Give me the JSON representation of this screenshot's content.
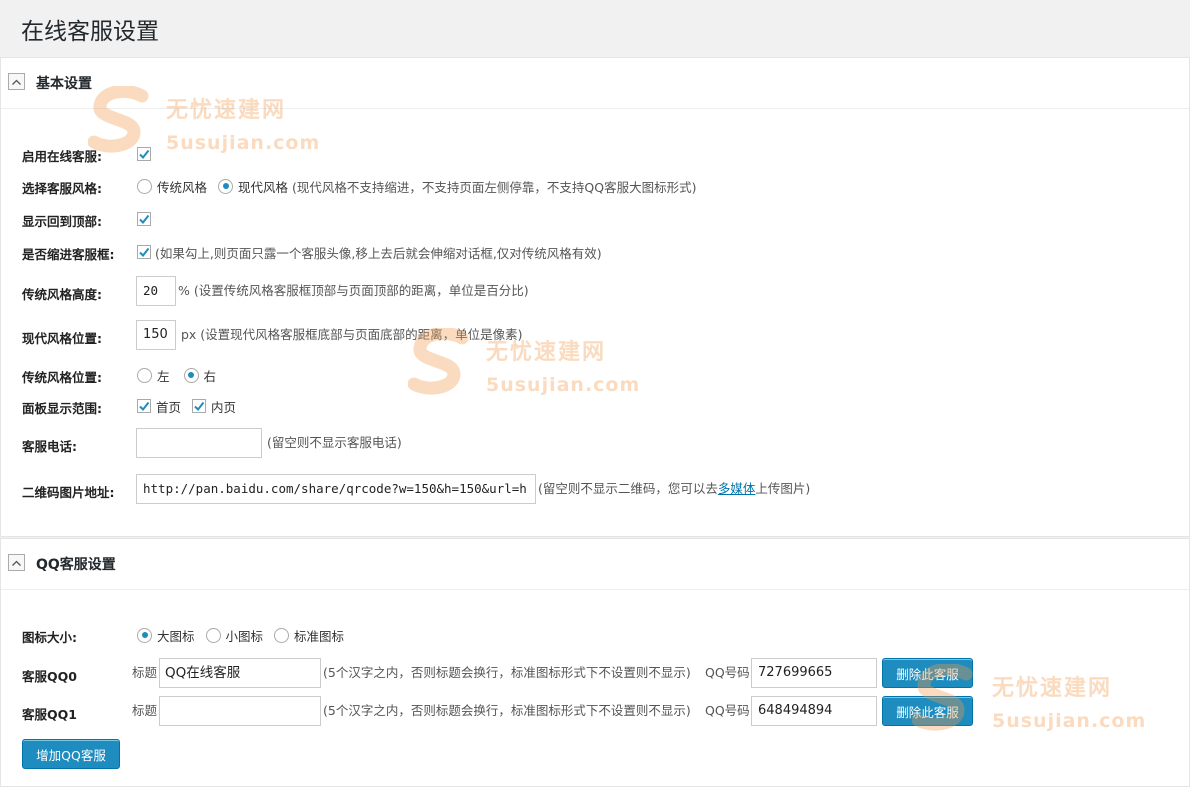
{
  "page": {
    "title": "在线客服设置"
  },
  "basic": {
    "title": "基本设置",
    "enable_label": "启用在线客服:",
    "style_label": "选择客服风格:",
    "style_options": [
      "传统风格",
      "现代风格"
    ],
    "style_selected": "现代风格",
    "style_note": "(现代风格不支持缩进，不支持页面左侧停靠，不支持QQ客服大图标形式)",
    "back_top_label": "显示回到顶部:",
    "indent_label": "是否缩进客服框:",
    "indent_note": "(如果勾上,则页面只露一个客服头像,移上去后就会伸缩对话框,仅对传统风格有效)",
    "height_label": "传统风格高度:",
    "height_value": "20",
    "height_note": "% (设置传统风格客服框顶部与页面顶部的距离，单位是百分比)",
    "modern_pos_label": "现代风格位置:",
    "modern_pos_value": "150",
    "modern_pos_note": "px (设置现代风格客服框底部与页面底部的距离，单位是像素)",
    "trad_pos_label": "传统风格位置:",
    "trad_pos_options": [
      "左",
      "右"
    ],
    "trad_pos_selected": "右",
    "scope_label": "面板显示范围:",
    "scope_options": [
      "首页",
      "内页"
    ],
    "phone_label": "客服电话:",
    "phone_value": "",
    "phone_note": "(留空则不显示客服电话)",
    "qrcode_label": "二维码图片地址:",
    "qrcode_value": "http://pan.baidu.com/share/qrcode?w=150&h=150&url=h",
    "qrcode_note_before": "(留空则不显示二维码，您可以去",
    "qrcode_note_link": "多媒体",
    "qrcode_note_after": "上传图片)"
  },
  "qq": {
    "title": "QQ客服设置",
    "icon_size_label": "图标大小:",
    "icon_size_options": [
      "大图标",
      "小图标",
      "标准图标"
    ],
    "icon_size_selected": "大图标",
    "title_prefix": "标题",
    "title_note": "(5个汉字之内，否则标题会换行，标准图标形式下不设置则不显示)",
    "qq_no_label": "QQ号码",
    "delete_label": "删除此客服",
    "add_label": "增加QQ客服",
    "rows": [
      {
        "label": "客服QQ0",
        "title": "QQ在线客服",
        "qq": "727699665"
      },
      {
        "label": "客服QQ1",
        "title": "",
        "qq": "648494894"
      }
    ]
  },
  "watermark": {
    "cn": "无忧速建网",
    "en": "5usujian.com"
  },
  "colors": {
    "accent": "#1e8cbe",
    "link": "#0073aa",
    "watermark": "#f39a4a"
  }
}
